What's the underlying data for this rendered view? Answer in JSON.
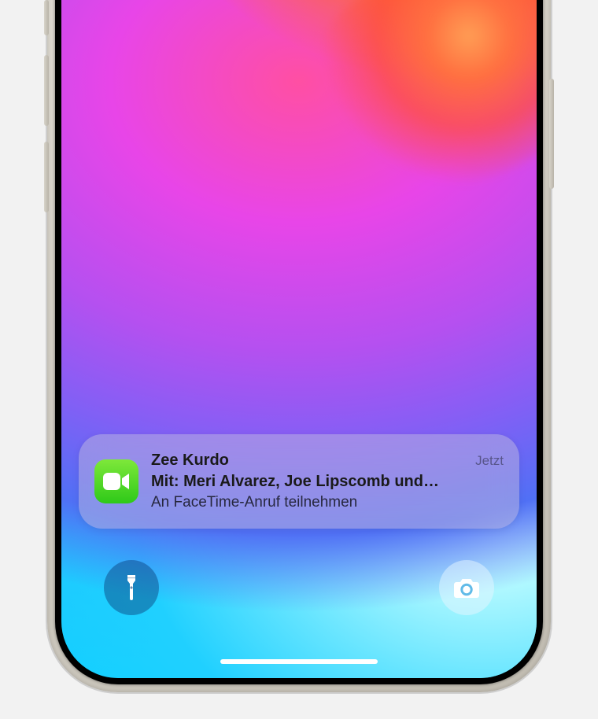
{
  "notification": {
    "title": "Zee Kurdo",
    "time": "Jetzt",
    "subtitle": "Mit: Meri Alvarez, Joe Lipscomb und…",
    "body": "An FaceTime-Anruf teilnehmen",
    "icon": "facetime-icon"
  },
  "quickActions": {
    "flashlight": "flashlight-icon",
    "camera": "camera-icon"
  }
}
